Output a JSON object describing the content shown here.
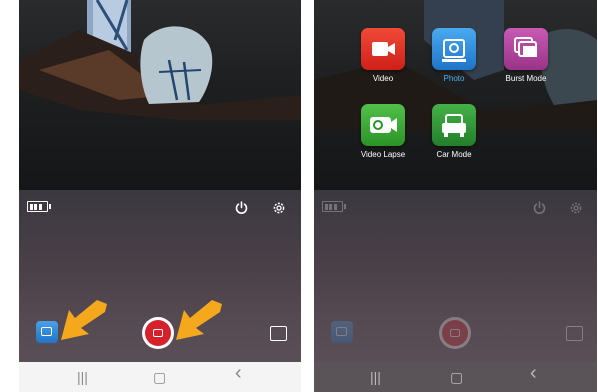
{
  "left_screen": {
    "nav_buttons": {
      "recents": "|||",
      "home": "▢",
      "back": "‹"
    }
  },
  "right_screen": {
    "modes": [
      {
        "label": "Video",
        "color": "#e5302a",
        "icon": "video-camera-icon"
      },
      {
        "label": "Photo",
        "color": "#2a8fe0",
        "icon": "photo-icon"
      },
      {
        "label": "Burst Mode",
        "color": "#b44aa0",
        "icon": "burst-icon"
      },
      {
        "label": "Video Lapse",
        "color": "#3fae3a",
        "icon": "video-lapse-icon"
      },
      {
        "label": "Car Mode",
        "color": "#2f9a3a",
        "icon": "car-icon"
      }
    ],
    "nav_buttons": {
      "recents": "|||",
      "home": "▢",
      "back": "‹"
    }
  },
  "colors": {
    "shutter_red": "#d6202b",
    "arrow_yellow": "#f5a81c",
    "selected_mode_text": "#4ab0f0"
  },
  "icons": [
    "battery-icon",
    "power-icon",
    "settings-gear-icon",
    "gallery-icon",
    "shutter-camera-icon",
    "fit-screen-icon",
    "arrow-icon"
  ]
}
